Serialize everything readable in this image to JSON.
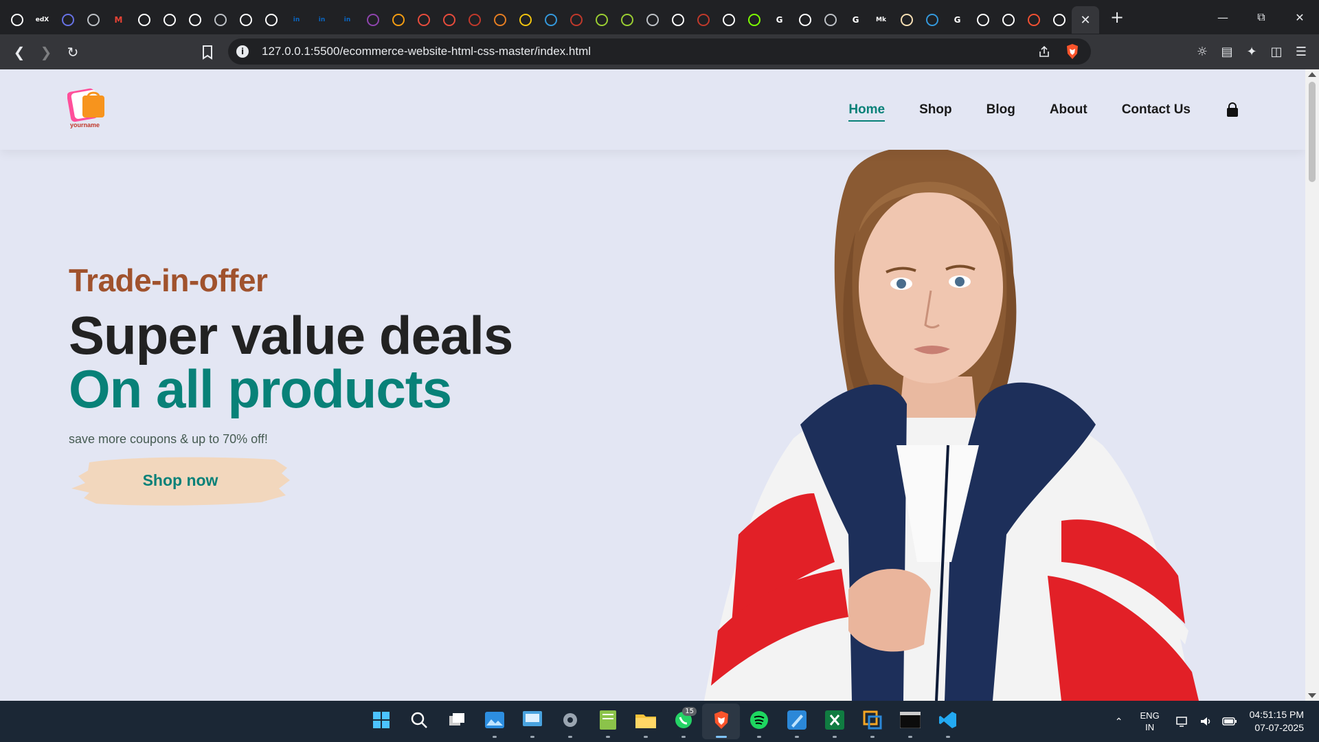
{
  "browser": {
    "tabs": [
      {
        "icon": "openai-icon",
        "color": "#ffffff"
      },
      {
        "icon": "edx-icon",
        "color": "#ffffff",
        "text": "edX"
      },
      {
        "icon": "stripe-icon",
        "color": "#6772e5"
      },
      {
        "icon": "globe-icon",
        "color": "#bdc1c6"
      },
      {
        "icon": "gmail-icon",
        "color": "#ea4335",
        "text": "M"
      },
      {
        "icon": "github-icon",
        "color": "#ffffff"
      },
      {
        "icon": "github-icon",
        "color": "#ffffff"
      },
      {
        "icon": "bag-icon",
        "color": "#ffffff"
      },
      {
        "icon": "globe-icon",
        "color": "#bdc1c6"
      },
      {
        "icon": "github-icon",
        "color": "#ffffff"
      },
      {
        "icon": "github-icon",
        "color": "#ffffff"
      },
      {
        "icon": "linkedin-icon",
        "color": "#0a66c2",
        "text": "in"
      },
      {
        "icon": "linkedin-icon",
        "color": "#0a66c2",
        "text": "in"
      },
      {
        "icon": "linkedin-icon",
        "color": "#0a66c2",
        "text": "in"
      },
      {
        "icon": "circle-icon",
        "color": "#8e44ad"
      },
      {
        "icon": "circle-icon",
        "color": "#f39c12"
      },
      {
        "icon": "circle-icon",
        "color": "#e74c3c"
      },
      {
        "icon": "circle-icon",
        "color": "#e74c3c"
      },
      {
        "icon": "cloud-icon",
        "color": "#c0392b"
      },
      {
        "icon": "circle-icon",
        "color": "#e67e22"
      },
      {
        "icon": "circle-icon",
        "color": "#f1c40f"
      },
      {
        "icon": "circle-icon",
        "color": "#3498db"
      },
      {
        "icon": "cloud-icon",
        "color": "#c0392b"
      },
      {
        "icon": "hex-icon",
        "color": "#9acd32"
      },
      {
        "icon": "hex-icon",
        "color": "#9acd32"
      },
      {
        "icon": "circle-icon",
        "color": "#bdc1c6"
      },
      {
        "icon": "circle-icon",
        "color": "#ffffff"
      },
      {
        "icon": "circle-icon",
        "color": "#c0392b"
      },
      {
        "icon": "doc-icon",
        "color": "#ffffff"
      },
      {
        "icon": "cube-icon",
        "color": "#7cfc00"
      },
      {
        "icon": "google-icon",
        "color": "#ffffff",
        "text": "G"
      },
      {
        "icon": "github-icon",
        "color": "#ffffff"
      },
      {
        "icon": "globe-icon",
        "color": "#bdc1c6"
      },
      {
        "icon": "google-icon",
        "color": "#ffffff",
        "text": "G"
      },
      {
        "icon": "medium-icon",
        "color": "#ffffff",
        "text": "Mk"
      },
      {
        "icon": "face-icon",
        "color": "#f5deb3"
      },
      {
        "icon": "wave-icon",
        "color": "#3498db"
      },
      {
        "icon": "google-icon",
        "color": "#ffffff",
        "text": "G"
      },
      {
        "icon": "codepen-icon",
        "color": "#ffffff"
      },
      {
        "icon": "github-icon",
        "color": "#ffffff"
      },
      {
        "icon": "git-icon",
        "color": "#f05032"
      },
      {
        "icon": "github-icon",
        "color": "#ffffff"
      }
    ],
    "address": "127.0.0.1:5500/ecommerce-website-html-css-master/index.html"
  },
  "site": {
    "logo_text": "yourname",
    "nav": [
      {
        "label": "Home",
        "active": true
      },
      {
        "label": "Shop",
        "active": false
      },
      {
        "label": "Blog",
        "active": false
      },
      {
        "label": "About",
        "active": false
      },
      {
        "label": "Contact Us",
        "active": false
      }
    ],
    "hero": {
      "offer": "Trade-in-offer",
      "headline": "Super value deals",
      "headline2": "On all products",
      "subtext": "save more coupons & up to 70% off!",
      "cta": "Shop now"
    },
    "colors": {
      "accent": "#088178",
      "offer": "#a0522d",
      "background": "#e3e6f3",
      "button_brush": "#f2d7bd"
    }
  },
  "taskbar": {
    "apps": [
      {
        "name": "start-icon"
      },
      {
        "name": "search-icon"
      },
      {
        "name": "task-view-icon"
      },
      {
        "name": "photos-icon"
      },
      {
        "name": "control-panel-icon"
      },
      {
        "name": "settings-icon"
      },
      {
        "name": "notepad-icon"
      },
      {
        "name": "file-explorer-icon"
      },
      {
        "name": "whatsapp-icon",
        "badge": "15"
      },
      {
        "name": "brave-icon"
      },
      {
        "name": "spotify-icon"
      },
      {
        "name": "paint-icon"
      },
      {
        "name": "excel-icon"
      },
      {
        "name": "remote-desktop-icon"
      },
      {
        "name": "terminal-icon"
      },
      {
        "name": "vscode-icon"
      }
    ],
    "language": "ENG",
    "region": "IN",
    "time": "04:51:15 PM",
    "date": "07-07-2025"
  }
}
